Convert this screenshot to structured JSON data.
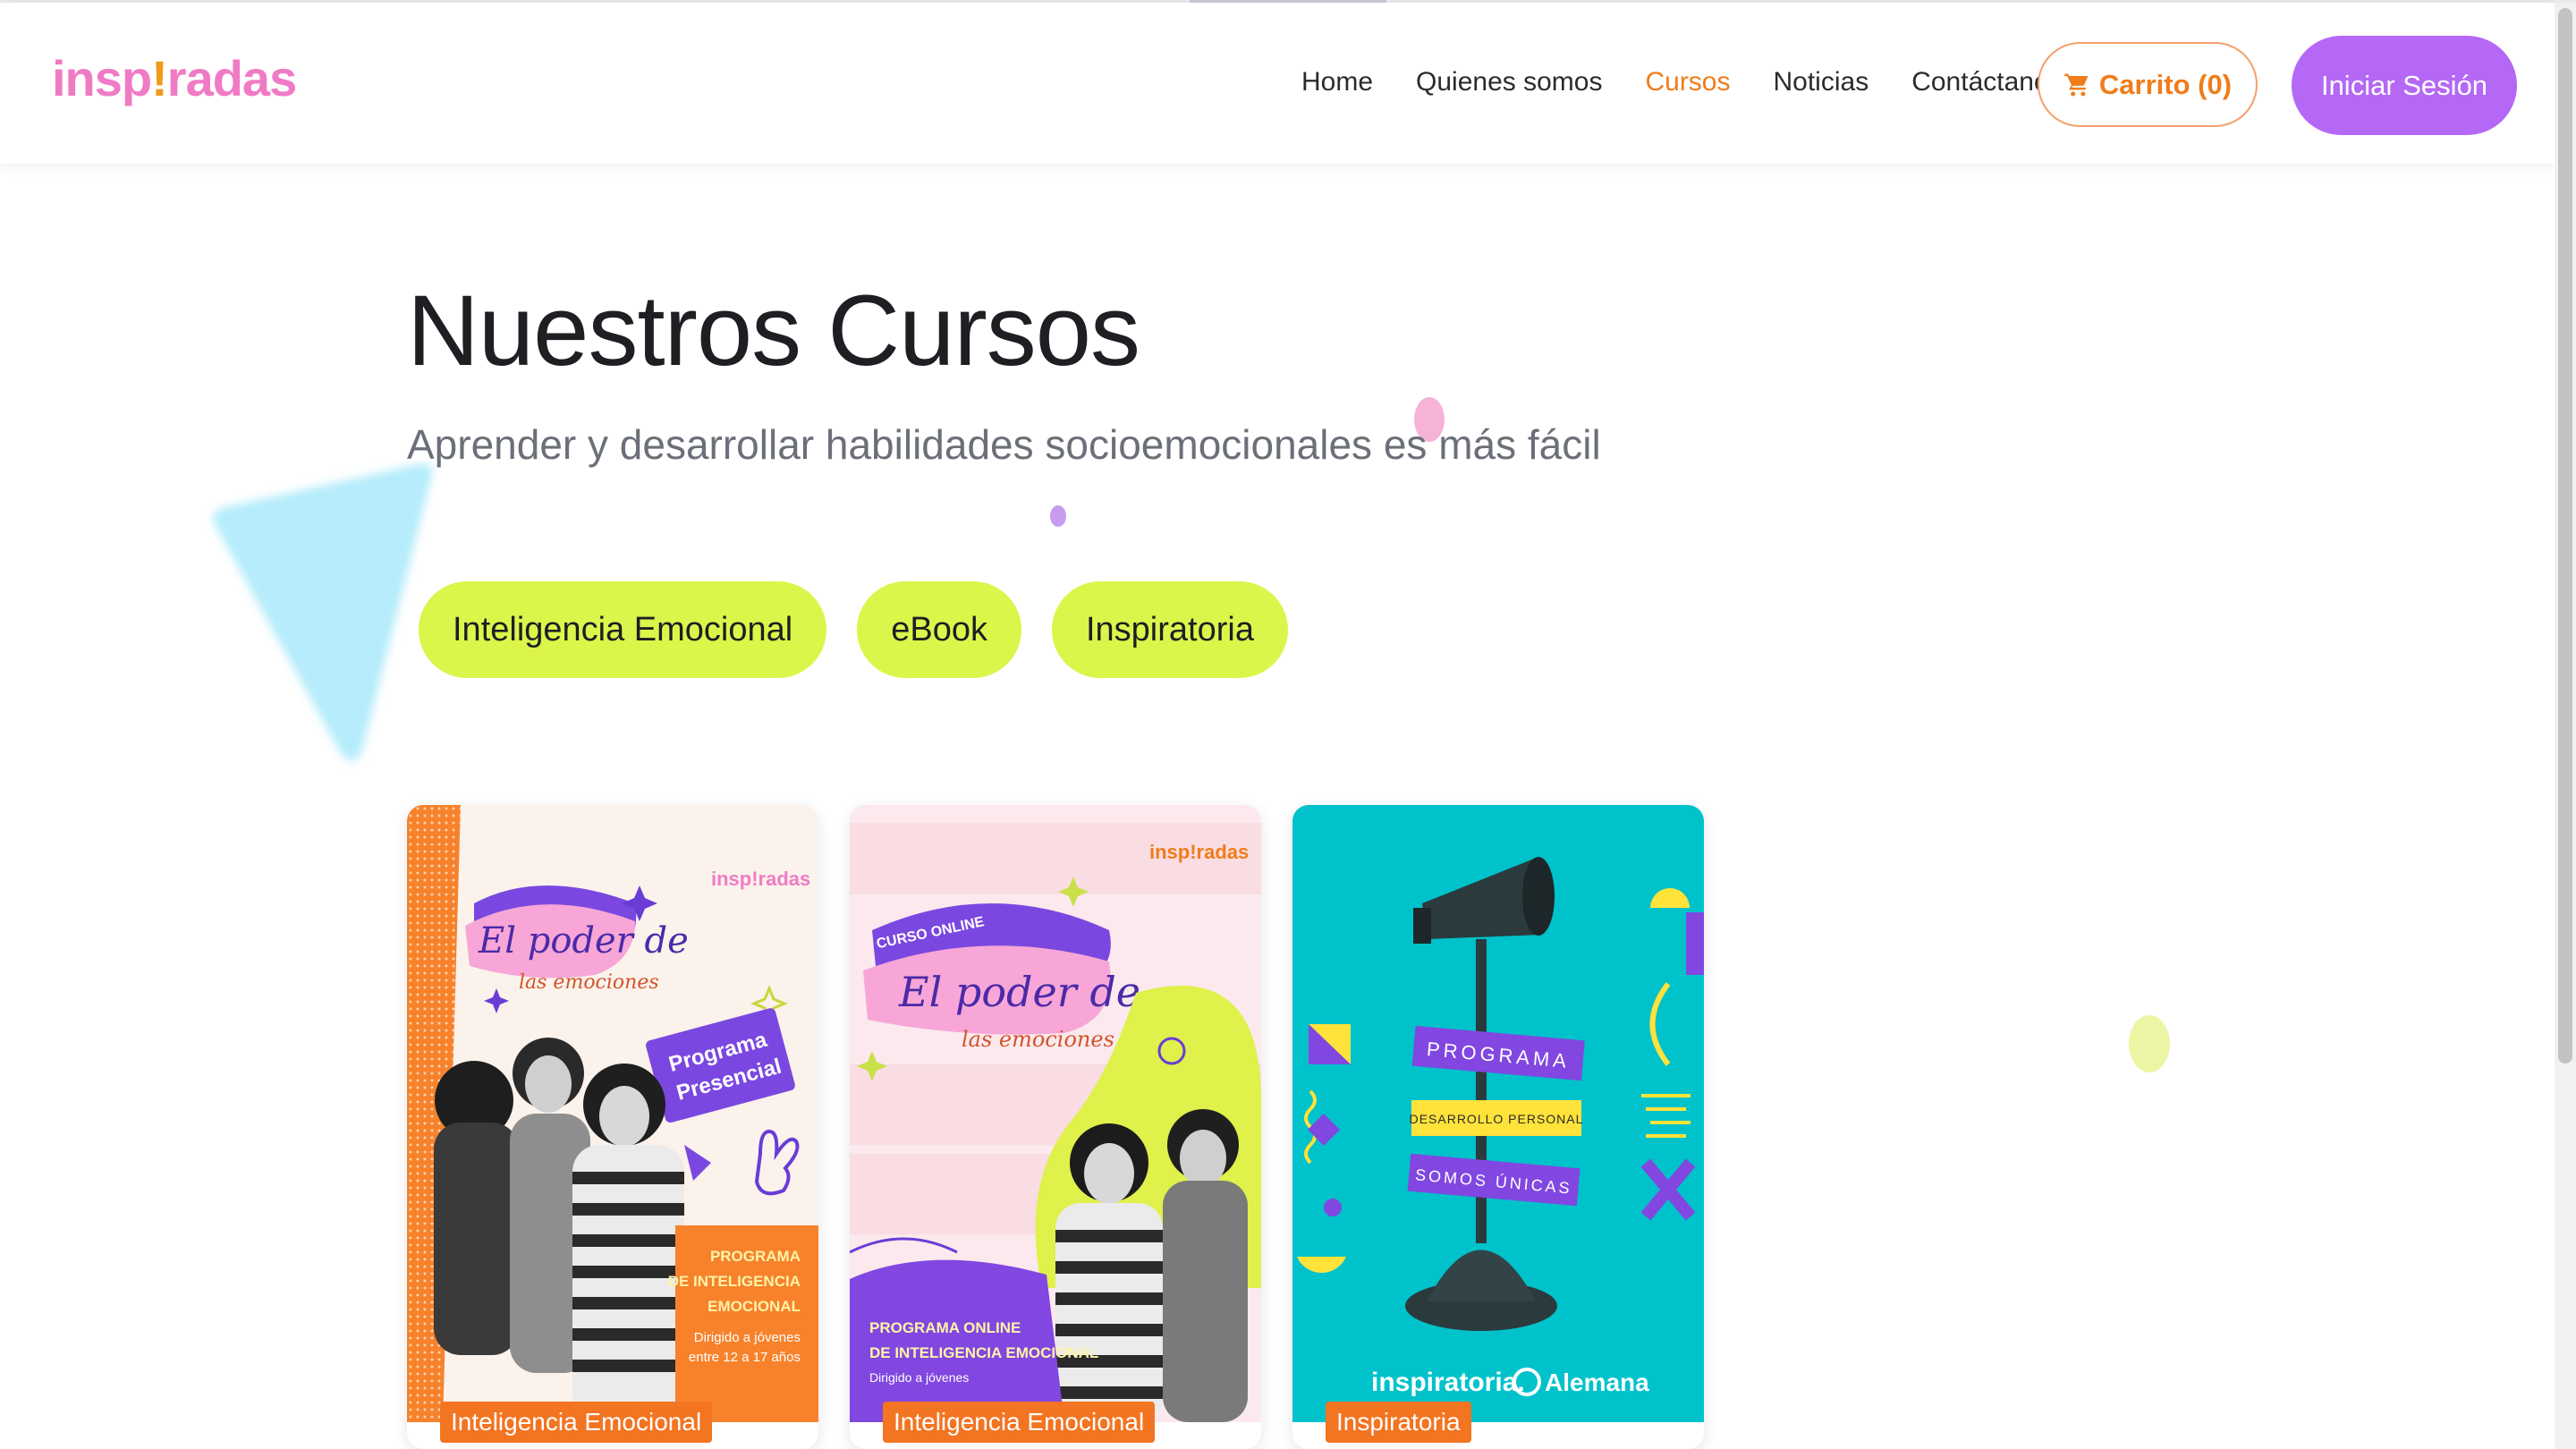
{
  "brand": {
    "logo_text_start": "insp",
    "logo_bang": "!",
    "logo_text_end": "radas",
    "colors": {
      "logo_pink": "#f07bc5",
      "accent_orange": "#f07c1a",
      "login_purple": "#b468f5",
      "filter_lime": "#dcf54a"
    }
  },
  "nav": {
    "links": [
      "Home",
      "Quienes somos",
      "Cursos",
      "Noticias",
      "Contáctanos"
    ],
    "active": "Cursos",
    "cart_label": "Carrito (0)",
    "cart_icon": "cart-icon",
    "login_label": "Iniciar Sesión"
  },
  "main": {
    "title": "Nuestros Cursos",
    "subtitle": "Aprender y desarrollar habilidades socioemocionales es más fácil",
    "filters": [
      "Inteligencia Emocional",
      "eBook",
      "Inspiratoria"
    ]
  },
  "cards": [
    {
      "badge": "Inteligencia Emocional",
      "image": {
        "brand": "insp!radas",
        "headline_1": "El poder de",
        "headline_2": "las emociones",
        "tag_1": "Programa",
        "tag_2": "Presencial",
        "program_1": "PROGRAMA",
        "program_2": "DE INTELIGENCIA",
        "program_3": "EMOCIONAL",
        "audience_1": "Dirigido a jóvenes",
        "audience_2": "entre 12 a 17 años"
      }
    },
    {
      "badge": "Inteligencia Emocional",
      "image": {
        "brand": "insp!radas",
        "kicker": "CURSO ONLINE",
        "headline_1": "El poder de",
        "headline_2": "las emociones",
        "program_1": "PROGRAMA ONLINE",
        "program_2": "DE INTELIGENCIA EMOCIONAL",
        "audience": "Dirigido a jóvenes"
      }
    },
    {
      "badge": "Inspiratoria",
      "image": {
        "label_1": "PROGRAMA",
        "label_2": "DESARROLLO PERSONAL",
        "label_3": "SOMOS ÚNICAS",
        "logo_1": "inspiratoria.",
        "logo_2": "Alemana"
      }
    }
  ]
}
